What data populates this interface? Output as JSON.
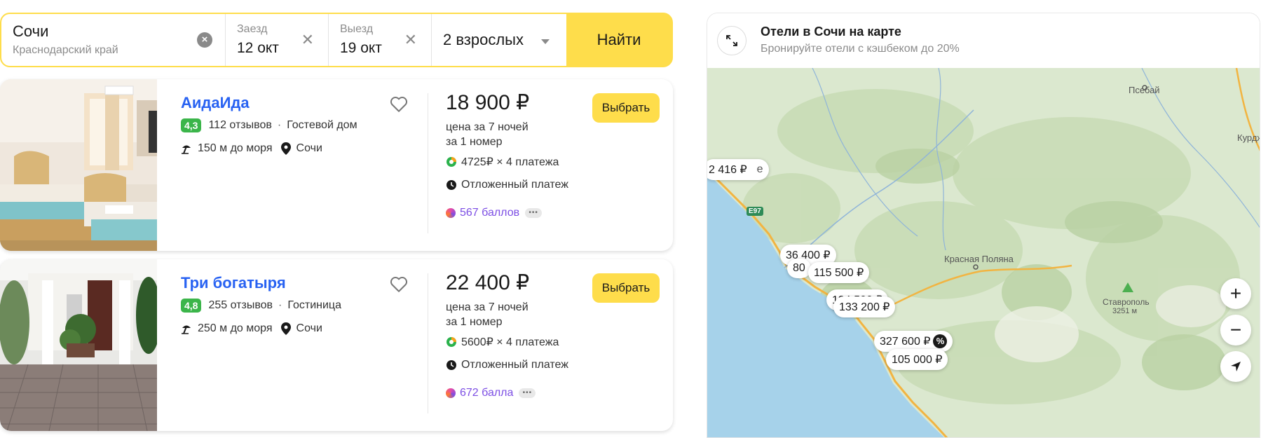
{
  "search": {
    "city": "Сочи",
    "region": "Краснодарский край",
    "checkin_label": "Заезд",
    "checkin_date": "12 окт",
    "checkout_label": "Выезд",
    "checkout_date": "19 окт",
    "guests": "2 взрослых",
    "find_label": "Найти"
  },
  "hotels": [
    {
      "name": "АидаИда",
      "rating": "4,3",
      "reviews": "112 отзывов",
      "type": "Гостевой дом",
      "distance": "150 м до моря",
      "city": "Сочи",
      "price": "18 900 ₽",
      "price_note_1": "цена за 7 ночей",
      "price_note_2": "за 1 номер",
      "installment": "4725₽ × 4 платежа",
      "deferred": "Отложенный платеж",
      "points": "567 баллов",
      "choose_label": "Выбрать"
    },
    {
      "name": "Три богатыря",
      "rating": "4,8",
      "reviews": "255 отзывов",
      "type": "Гостиница",
      "distance": "250 м до моря",
      "city": "Сочи",
      "price": "22 400 ₽",
      "price_note_1": "цена за 7 ночей",
      "price_note_2": "за 1 номер",
      "installment": "5600₽ × 4 платежа",
      "deferred": "Отложенный платеж",
      "points": "672 балла",
      "choose_label": "Выбрать"
    }
  ],
  "map": {
    "title": "Отели в Сочи на карте",
    "subtitle": "Бронируйте отели с кэшбеком до 20%",
    "zoom_in": "+",
    "zoom_out": "−",
    "place_labels": {
      "psebay": "Псебай",
      "kurdzh": "Курдж",
      "krasnaya_polyana": "Красная Поляна",
      "stavropol": "Ставрополь",
      "stavropol_height": "3251 м",
      "e_fragment": "е"
    },
    "road": "E97",
    "price_pins": [
      "2 416 ₽",
      "36 400 ₽",
      "80",
      "115 500 ₽",
      "134 500 ₽",
      "133 200 ₽",
      "327 600 ₽",
      "105 000 ₽"
    ],
    "discount_badge": "%"
  },
  "colors": {
    "accent_yellow": "#fedd4b",
    "link_blue": "#2862f2",
    "rating_green": "#3bb54a",
    "points_purple": "#7c4ee4",
    "sea_blue": "#a6d2ea",
    "land_green": "#d7e6c9"
  }
}
